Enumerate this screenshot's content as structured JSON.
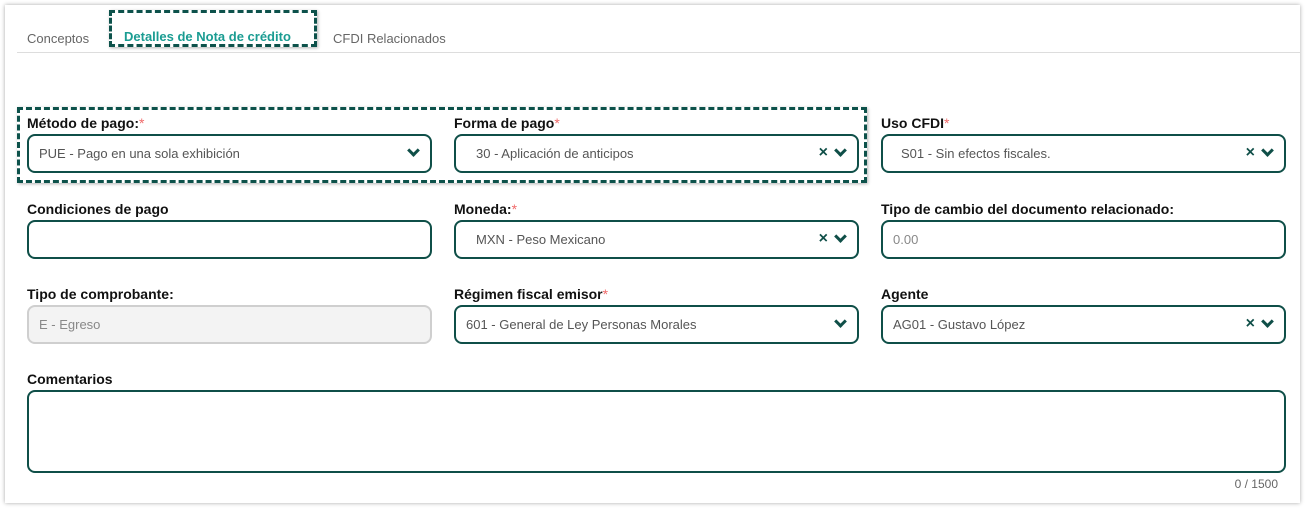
{
  "tabs": [
    {
      "label": "Conceptos"
    },
    {
      "label": "Detalles de Nota de crédito"
    },
    {
      "label": "CFDI Relacionados"
    }
  ],
  "required_mark": "*",
  "fields": {
    "metodo": {
      "label": "Método de pago:",
      "value": "PUE - Pago en una sola exhibición"
    },
    "forma": {
      "label": "Forma de pago",
      "value": "30 - Aplicación de anticipos"
    },
    "uso": {
      "label": "Uso CFDI",
      "value": "S01 - Sin efectos fiscales."
    },
    "condiciones": {
      "label": "Condiciones de pago",
      "value": ""
    },
    "moneda": {
      "label": "Moneda:",
      "value": "MXN - Peso Mexicano"
    },
    "tipo_cambio": {
      "label": "Tipo de cambio del documento relacionado:",
      "placeholder": "0.00"
    },
    "tipo_comprobante": {
      "label": "Tipo de comprobante:",
      "value": "E - Egreso"
    },
    "regimen": {
      "label": "Régimen fiscal emisor",
      "value": "601 - General de Ley Personas Morales"
    },
    "agente": {
      "label": "Agente",
      "value": "AG01 - Gustavo López"
    },
    "comentarios": {
      "label": "Comentarios",
      "counter": "0 / 1500"
    }
  },
  "icons": {
    "clear": "×"
  }
}
